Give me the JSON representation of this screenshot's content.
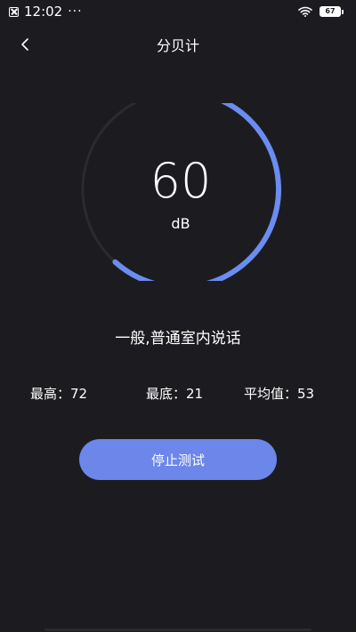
{
  "status_bar": {
    "time": "12:02",
    "more_indicator": "···",
    "battery_level": "67"
  },
  "header": {
    "title": "分贝计",
    "back_icon": "chevron-left-icon"
  },
  "gauge": {
    "value": "60",
    "unit": "dB",
    "level_fraction": 0.6,
    "track_color": "#2a2a2f",
    "progress_color": "#6b8cf0"
  },
  "description": "一般,普通室内说话",
  "stats": {
    "max_label": "最高：72",
    "min_label": "最底：21",
    "avg_label": "平均值：53"
  },
  "actions": {
    "stop_label": "停止测试",
    "stop_color": "#6c86ea"
  }
}
